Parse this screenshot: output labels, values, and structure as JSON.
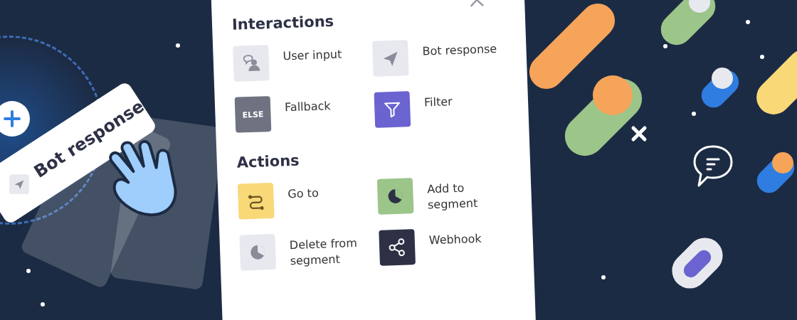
{
  "dragged_card": {
    "label": "Bot response"
  },
  "sections": [
    {
      "title": "Interactions",
      "items": [
        {
          "label": "User input",
          "kind": "user",
          "color": "#e8e9ef"
        },
        {
          "label": "Bot response",
          "kind": "plane",
          "color": "#e8e9ef"
        },
        {
          "label": "Fallback",
          "kind": "else",
          "color": "#6f7280",
          "icon_text": "ELSE"
        },
        {
          "label": "Filter",
          "kind": "filter",
          "color": "#6b63cf"
        }
      ]
    },
    {
      "title": "Actions",
      "items": [
        {
          "label": "Go to",
          "kind": "goto",
          "color": "#f9d878"
        },
        {
          "label": "Add to segment",
          "kind": "pie",
          "color": "#9cc58a"
        },
        {
          "label": "Delete from segment",
          "kind": "pie",
          "color": "#e8e9ef"
        },
        {
          "label": "Webhook",
          "kind": "share",
          "color": "#2e3146"
        }
      ]
    }
  ]
}
